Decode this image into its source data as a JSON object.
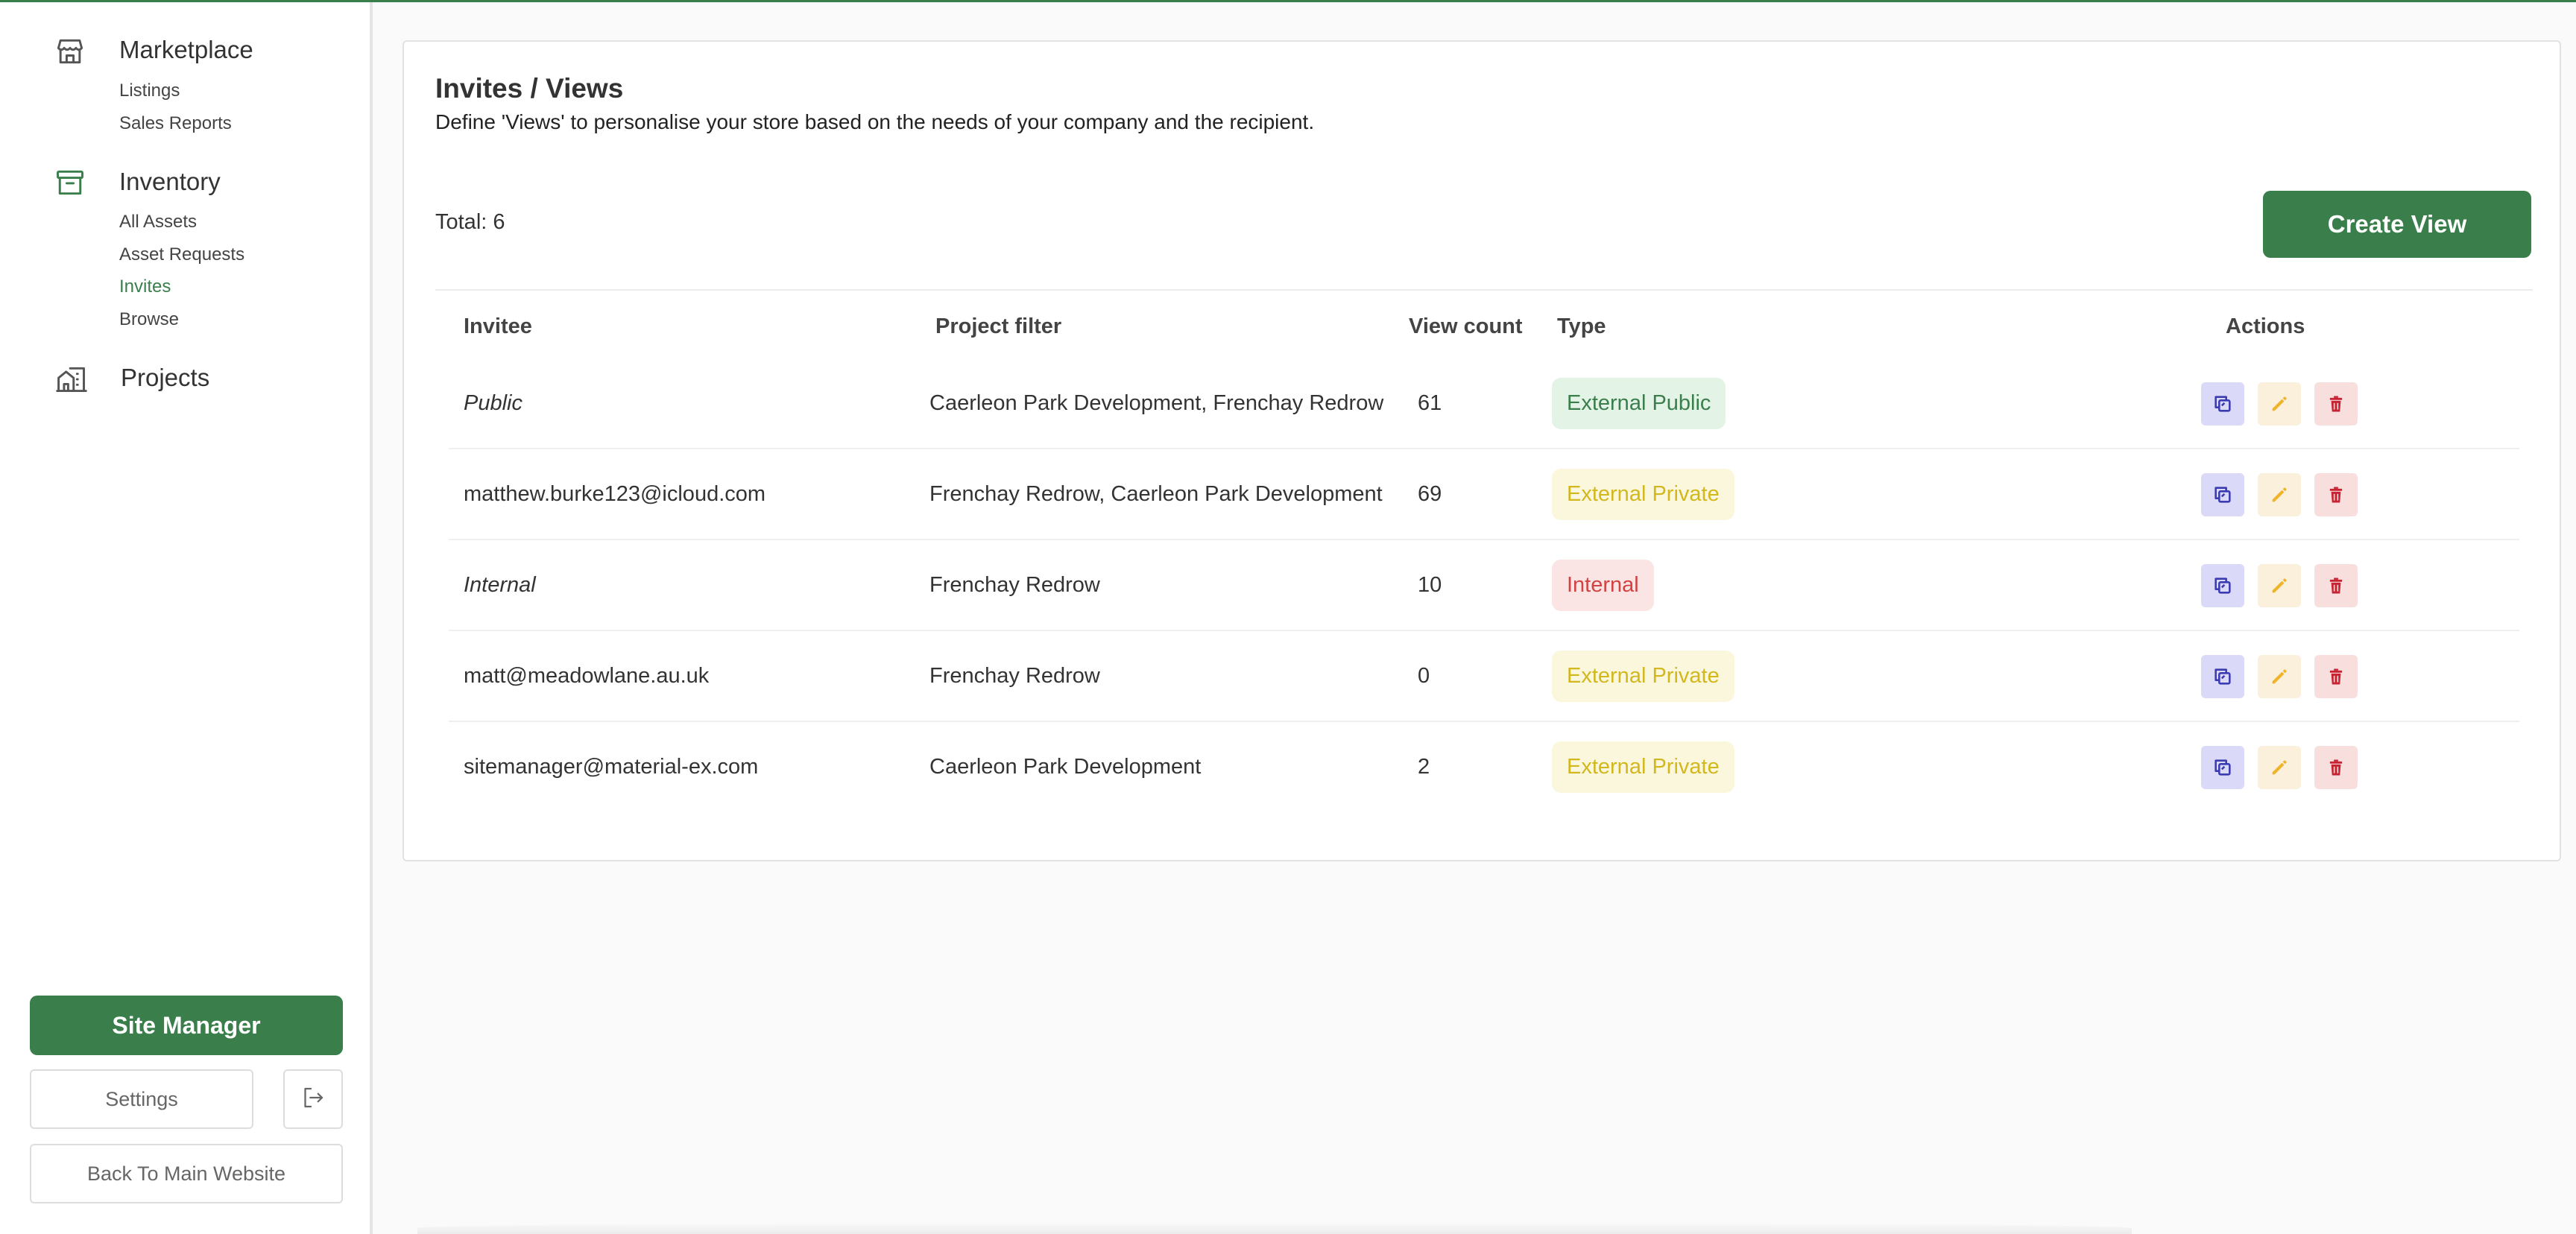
{
  "sidebar": {
    "groups": [
      {
        "title": "Marketplace",
        "icon": "store-icon",
        "items": [
          "Listings",
          "Sales Reports"
        ]
      },
      {
        "title": "Inventory",
        "icon": "archive-box-icon",
        "items": [
          "All Assets",
          "Asset Requests",
          "Invites",
          "Browse"
        ]
      },
      {
        "title": "Projects",
        "icon": "buildings-icon",
        "items": []
      }
    ],
    "active_item": "Invites",
    "site_manager_label": "Site Manager",
    "settings_label": "Settings",
    "back_label": "Back To Main Website"
  },
  "main": {
    "title": "Invites / Views",
    "description": "Define 'Views' to personalise your store based on the needs of your company and the recipient.",
    "total_label": "Total: 6",
    "create_label": "Create View",
    "columns": {
      "invitee": "Invitee",
      "project_filter": "Project filter",
      "view_count": "View count",
      "type": "Type",
      "actions": "Actions"
    },
    "rows": [
      {
        "invitee": "Public",
        "italic": true,
        "project_filter": "Caerleon Park Development, Frenchay Redrow",
        "view_count": "61",
        "type": "External Public",
        "type_style": "public"
      },
      {
        "invitee": "matthew.burke123@icloud.com",
        "italic": false,
        "project_filter": "Frenchay Redrow, Caerleon Park Development",
        "view_count": "69",
        "type": "External Private",
        "type_style": "private"
      },
      {
        "invitee": "Internal",
        "italic": true,
        "project_filter": "Frenchay Redrow",
        "view_count": "10",
        "type": "Internal",
        "type_style": "internal"
      },
      {
        "invitee": "matt@meadowlane.au.uk",
        "italic": false,
        "project_filter": "Frenchay Redrow",
        "view_count": "0",
        "type": "External Private",
        "type_style": "private"
      },
      {
        "invitee": "sitemanager@material-ex.com",
        "italic": false,
        "project_filter": "Caerleon Park Development",
        "view_count": "2",
        "type": "External Private",
        "type_style": "private"
      }
    ],
    "action_icons": [
      "copy-icon",
      "pencil-icon",
      "trash-icon"
    ]
  },
  "colors": {
    "brand": "#3a7f4b",
    "public_bg": "#e3f3e6",
    "private_bg": "#fbf7dd",
    "private_text": "#d2b81d",
    "internal_bg": "#fbe4e4",
    "internal_text": "#d14343",
    "copy_bg": "#dad9f7",
    "copy_icon": "#3b3bb3",
    "edit_icon": "#f0b429",
    "delete_icon": "#c82333"
  }
}
